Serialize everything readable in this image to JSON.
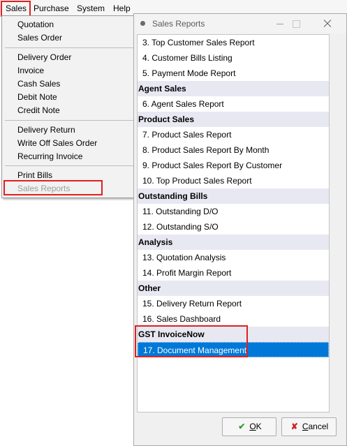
{
  "menubar": {
    "items": [
      "Sales",
      "Purchase",
      "System",
      "Help"
    ]
  },
  "sales_menu": {
    "items": [
      "Quotation",
      "Sales Order",
      "Delivery Order",
      "Invoice",
      "Cash Sales",
      "Debit Note",
      "Credit Note",
      "Delivery Return",
      "Write Off Sales Order",
      "Recurring Invoice",
      "Print Bills",
      "Sales Reports"
    ]
  },
  "dialog": {
    "title": "Sales Reports",
    "rows": [
      {
        "text": "3. Top Customer Sales Report",
        "kind": "item"
      },
      {
        "text": "4. Customer Bills Listing",
        "kind": "item"
      },
      {
        "text": "5. Payment Mode Report",
        "kind": "item"
      },
      {
        "text": "Agent Sales",
        "kind": "group"
      },
      {
        "text": "6. Agent Sales Report",
        "kind": "item"
      },
      {
        "text": "Product Sales",
        "kind": "group"
      },
      {
        "text": "7. Product Sales Report",
        "kind": "item"
      },
      {
        "text": "8. Product Sales Report By Month",
        "kind": "item"
      },
      {
        "text": "9. Product Sales Report By Customer",
        "kind": "item"
      },
      {
        "text": "10. Top Product Sales Report",
        "kind": "item"
      },
      {
        "text": "Outstanding Bills",
        "kind": "group"
      },
      {
        "text": "11. Outstanding D/O",
        "kind": "item"
      },
      {
        "text": "12. Outstanding S/O",
        "kind": "item"
      },
      {
        "text": "Analysis",
        "kind": "group"
      },
      {
        "text": "13. Quotation Analysis",
        "kind": "item"
      },
      {
        "text": "14. Profit Margin Report",
        "kind": "item"
      },
      {
        "text": "Other",
        "kind": "group"
      },
      {
        "text": "15. Delivery Return Report",
        "kind": "item"
      },
      {
        "text": "16. Sales Dashboard",
        "kind": "item"
      },
      {
        "text": "GST InvoiceNow",
        "kind": "group"
      },
      {
        "text": "17. Document Management",
        "kind": "selected"
      }
    ],
    "ok_label": "OK",
    "ok_underline": "O",
    "ok_rest": "K",
    "cancel_label": "Cancel",
    "cancel_underline": "C",
    "cancel_rest": "ancel",
    "ok_icon": "check-icon",
    "cancel_icon": "x-icon"
  },
  "colors": {
    "highlight_red": "#e02020",
    "selection_blue": "#0078d7",
    "group_band": "#e8e8f2"
  }
}
